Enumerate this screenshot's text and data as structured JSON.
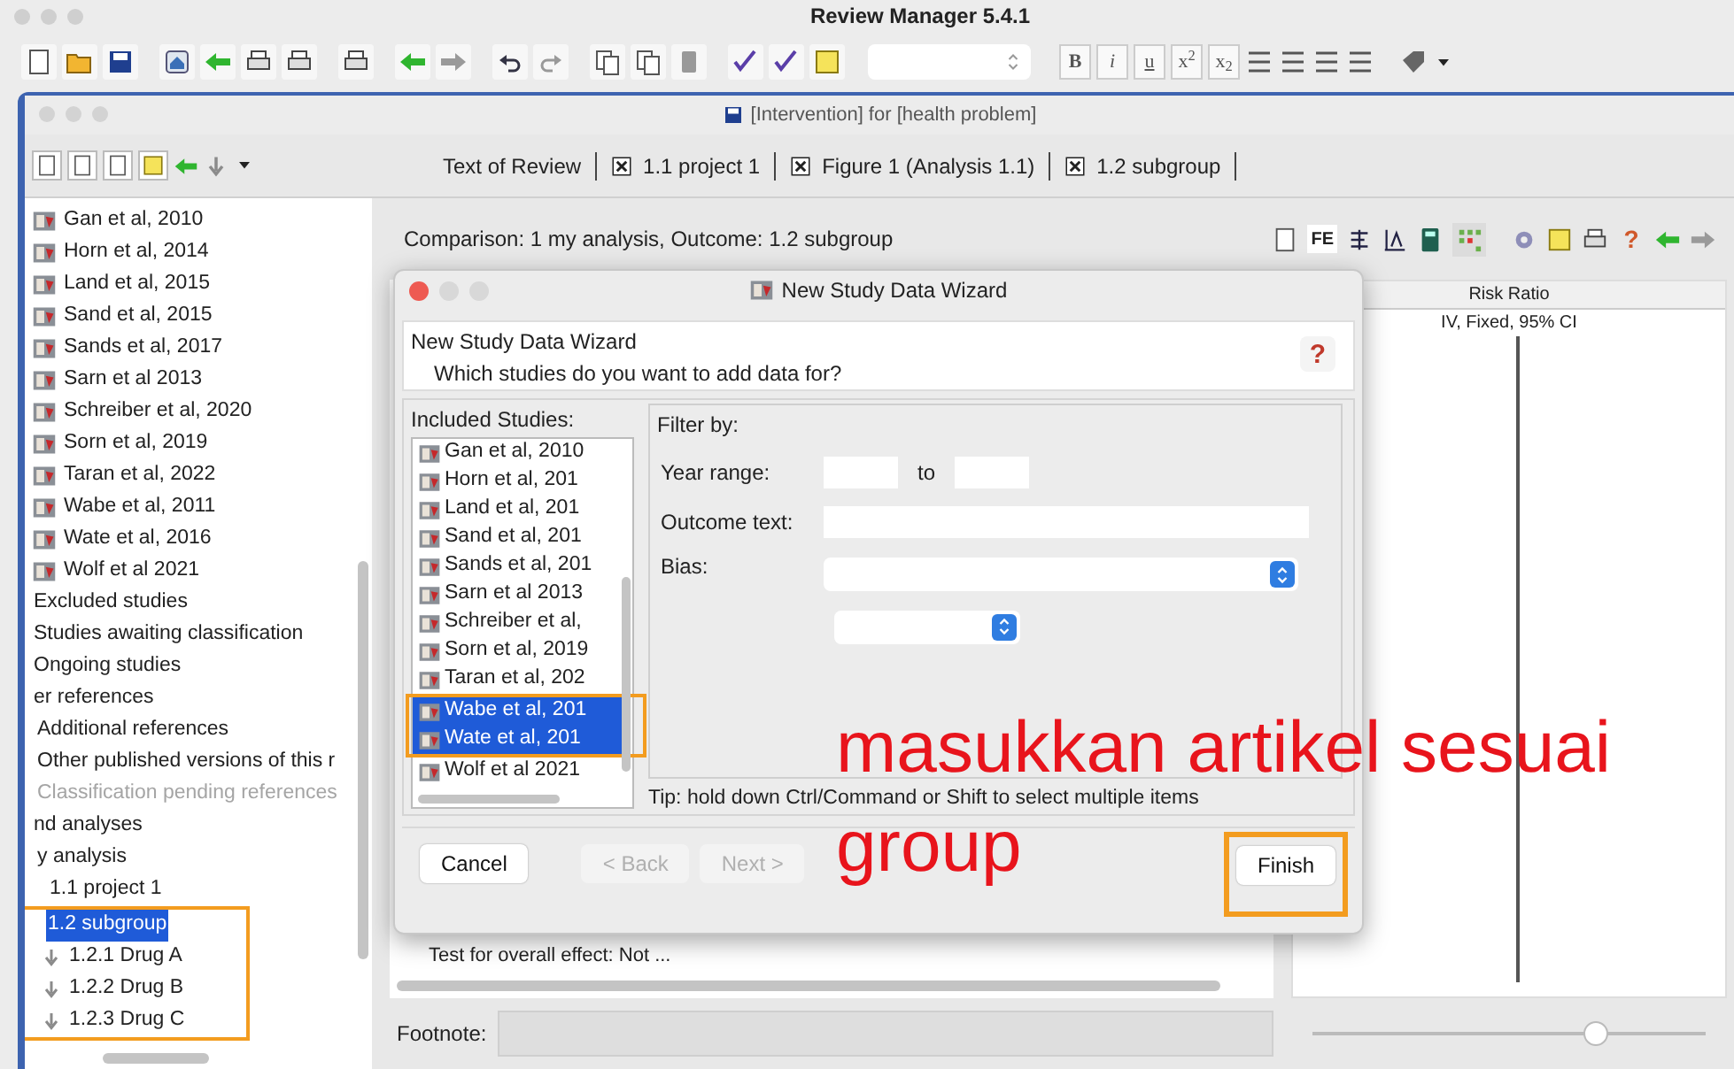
{
  "app": {
    "title": "Review Manager 5.4.1"
  },
  "toolbar": {
    "format_buttons": [
      "B",
      "i",
      "u",
      "x$^{2}$",
      "x$_{2}$"
    ]
  },
  "document": {
    "title": "[Intervention] for [health problem]"
  },
  "tabs": [
    {
      "label": "Text of Review",
      "closable": false
    },
    {
      "label": "1.1 project 1",
      "closable": true
    },
    {
      "label": "Figure 1 (Analysis 1.1)",
      "closable": true
    },
    {
      "label": "1.2 subgroup",
      "closable": true
    }
  ],
  "tree": [
    {
      "label": "Gan et al, 2010",
      "kind": "study"
    },
    {
      "label": "Horn et al, 2014",
      "kind": "study"
    },
    {
      "label": "Land et al, 2015",
      "kind": "study"
    },
    {
      "label": "Sand et al, 2015",
      "kind": "study"
    },
    {
      "label": "Sands et al, 2017",
      "kind": "study"
    },
    {
      "label": "Sarn et al 2013",
      "kind": "study"
    },
    {
      "label": "Schreiber et al, 2020",
      "kind": "study"
    },
    {
      "label": "Sorn et al, 2019",
      "kind": "study"
    },
    {
      "label": "Taran et al, 2022",
      "kind": "study"
    },
    {
      "label": "Wabe et al, 2011",
      "kind": "study"
    },
    {
      "label": "Wate et al, 2016",
      "kind": "study"
    },
    {
      "label": "Wolf et al 2021",
      "kind": "study"
    },
    {
      "label": "Excluded studies",
      "kind": "section"
    },
    {
      "label": "Studies awaiting classification",
      "kind": "section"
    },
    {
      "label": "Ongoing studies",
      "kind": "section"
    },
    {
      "label": "er references",
      "kind": "section",
      "children": [
        {
          "label": "Additional references",
          "kind": "section"
        },
        {
          "label": "Other published versions of this r",
          "kind": "section"
        },
        {
          "label": "Classification pending references",
          "kind": "section",
          "disabled": true
        }
      ]
    },
    {
      "label": "nd analyses",
      "kind": "section",
      "children": [
        {
          "label": "y analysis",
          "kind": "section",
          "children": [
            {
              "label": "1.1 project 1",
              "kind": "analysis",
              "selected": false
            },
            {
              "label": "1.2 subgroup",
              "kind": "analysis",
              "selected": true,
              "children": [
                {
                  "label": "1.2.1 Drug A",
                  "kind": "subgroup"
                },
                {
                  "label": "1.2.2 Drug B",
                  "kind": "subgroup"
                },
                {
                  "label": "1.2.3 Drug C",
                  "kind": "subgroup"
                }
              ]
            }
          ]
        }
      ]
    }
  ],
  "comparison": "Comparison: 1 my analysis, Outcome: 1.2 subgroup",
  "analysis_toolbar": {
    "fe_label": "FE",
    "help": "?"
  },
  "forest": {
    "heading": "Risk Ratio",
    "method": "IV, Fixed, 95% CI",
    "overall_effect": "Test for overall effect: Not ..."
  },
  "footnote": {
    "label": "Footnote:"
  },
  "zoom_slider": {
    "level": 0.72
  },
  "dialog": {
    "title": "New Study Data Wizard",
    "heading": "New Study Data Wizard",
    "question": "Which studies do you want to add data for?",
    "help": "?",
    "list_label": "Included Studies:",
    "studies": [
      {
        "label": "Gan et al, 2010",
        "selected": false
      },
      {
        "label": "Horn et al, 201",
        "selected": false
      },
      {
        "label": "Land et al, 201",
        "selected": false
      },
      {
        "label": "Sand et al, 201",
        "selected": false
      },
      {
        "label": "Sands et al, 201",
        "selected": false
      },
      {
        "label": "Sarn et al 2013",
        "selected": false
      },
      {
        "label": "Schreiber et al,",
        "selected": false
      },
      {
        "label": "Sorn et al, 2019",
        "selected": false
      },
      {
        "label": "Taran et al, 202",
        "selected": false
      },
      {
        "label": "Wabe et al, 201",
        "selected": true
      },
      {
        "label": "Wate et al, 201",
        "selected": true
      },
      {
        "label": "Wolf et al 2021",
        "selected": false
      }
    ],
    "filter": {
      "title": "Filter by:",
      "year_label": "Year range:",
      "to_label": "to",
      "outcome_label": "Outcome text:",
      "bias_label": "Bias:"
    },
    "tip": "Tip: hold down Ctrl/Command or Shift to select multiple items",
    "buttons": [
      {
        "label": "Cancel",
        "disabled": false
      },
      {
        "label": "< Back",
        "disabled": true
      },
      {
        "label": "Next >",
        "disabled": true
      },
      {
        "label": "Finish",
        "disabled": false
      }
    ]
  },
  "annotation": [
    "masukkan artikel sesuai",
    "group"
  ]
}
